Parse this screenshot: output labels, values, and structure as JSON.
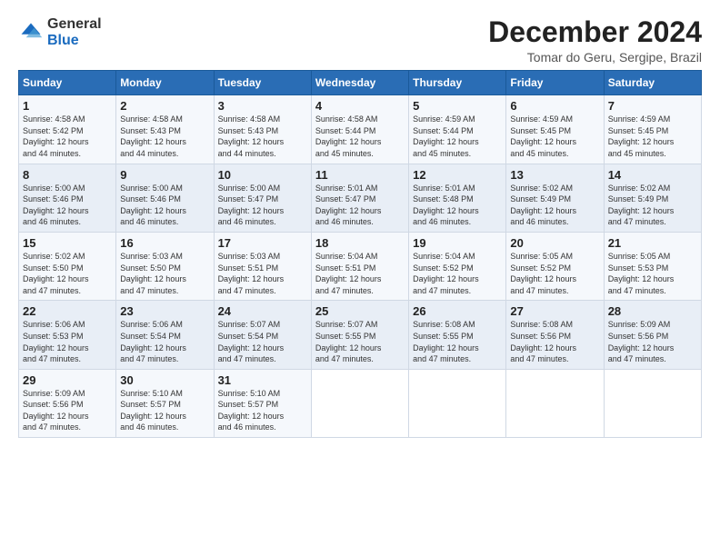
{
  "logo": {
    "general": "General",
    "blue": "Blue"
  },
  "title": "December 2024",
  "location": "Tomar do Geru, Sergipe, Brazil",
  "days_of_week": [
    "Sunday",
    "Monday",
    "Tuesday",
    "Wednesday",
    "Thursday",
    "Friday",
    "Saturday"
  ],
  "weeks": [
    [
      {
        "day": "1",
        "sunrise": "4:58 AM",
        "sunset": "5:42 PM",
        "daylight": "12 hours and 44 minutes."
      },
      {
        "day": "2",
        "sunrise": "4:58 AM",
        "sunset": "5:43 PM",
        "daylight": "12 hours and 44 minutes."
      },
      {
        "day": "3",
        "sunrise": "4:58 AM",
        "sunset": "5:43 PM",
        "daylight": "12 hours and 44 minutes."
      },
      {
        "day": "4",
        "sunrise": "4:58 AM",
        "sunset": "5:44 PM",
        "daylight": "12 hours and 45 minutes."
      },
      {
        "day": "5",
        "sunrise": "4:59 AM",
        "sunset": "5:44 PM",
        "daylight": "12 hours and 45 minutes."
      },
      {
        "day": "6",
        "sunrise": "4:59 AM",
        "sunset": "5:45 PM",
        "daylight": "12 hours and 45 minutes."
      },
      {
        "day": "7",
        "sunrise": "4:59 AM",
        "sunset": "5:45 PM",
        "daylight": "12 hours and 45 minutes."
      }
    ],
    [
      {
        "day": "8",
        "sunrise": "5:00 AM",
        "sunset": "5:46 PM",
        "daylight": "12 hours and 46 minutes."
      },
      {
        "day": "9",
        "sunrise": "5:00 AM",
        "sunset": "5:46 PM",
        "daylight": "12 hours and 46 minutes."
      },
      {
        "day": "10",
        "sunrise": "5:00 AM",
        "sunset": "5:47 PM",
        "daylight": "12 hours and 46 minutes."
      },
      {
        "day": "11",
        "sunrise": "5:01 AM",
        "sunset": "5:47 PM",
        "daylight": "12 hours and 46 minutes."
      },
      {
        "day": "12",
        "sunrise": "5:01 AM",
        "sunset": "5:48 PM",
        "daylight": "12 hours and 46 minutes."
      },
      {
        "day": "13",
        "sunrise": "5:02 AM",
        "sunset": "5:49 PM",
        "daylight": "12 hours and 46 minutes."
      },
      {
        "day": "14",
        "sunrise": "5:02 AM",
        "sunset": "5:49 PM",
        "daylight": "12 hours and 47 minutes."
      }
    ],
    [
      {
        "day": "15",
        "sunrise": "5:02 AM",
        "sunset": "5:50 PM",
        "daylight": "12 hours and 47 minutes."
      },
      {
        "day": "16",
        "sunrise": "5:03 AM",
        "sunset": "5:50 PM",
        "daylight": "12 hours and 47 minutes."
      },
      {
        "day": "17",
        "sunrise": "5:03 AM",
        "sunset": "5:51 PM",
        "daylight": "12 hours and 47 minutes."
      },
      {
        "day": "18",
        "sunrise": "5:04 AM",
        "sunset": "5:51 PM",
        "daylight": "12 hours and 47 minutes."
      },
      {
        "day": "19",
        "sunrise": "5:04 AM",
        "sunset": "5:52 PM",
        "daylight": "12 hours and 47 minutes."
      },
      {
        "day": "20",
        "sunrise": "5:05 AM",
        "sunset": "5:52 PM",
        "daylight": "12 hours and 47 minutes."
      },
      {
        "day": "21",
        "sunrise": "5:05 AM",
        "sunset": "5:53 PM",
        "daylight": "12 hours and 47 minutes."
      }
    ],
    [
      {
        "day": "22",
        "sunrise": "5:06 AM",
        "sunset": "5:53 PM",
        "daylight": "12 hours and 47 minutes."
      },
      {
        "day": "23",
        "sunrise": "5:06 AM",
        "sunset": "5:54 PM",
        "daylight": "12 hours and 47 minutes."
      },
      {
        "day": "24",
        "sunrise": "5:07 AM",
        "sunset": "5:54 PM",
        "daylight": "12 hours and 47 minutes."
      },
      {
        "day": "25",
        "sunrise": "5:07 AM",
        "sunset": "5:55 PM",
        "daylight": "12 hours and 47 minutes."
      },
      {
        "day": "26",
        "sunrise": "5:08 AM",
        "sunset": "5:55 PM",
        "daylight": "12 hours and 47 minutes."
      },
      {
        "day": "27",
        "sunrise": "5:08 AM",
        "sunset": "5:56 PM",
        "daylight": "12 hours and 47 minutes."
      },
      {
        "day": "28",
        "sunrise": "5:09 AM",
        "sunset": "5:56 PM",
        "daylight": "12 hours and 47 minutes."
      }
    ],
    [
      {
        "day": "29",
        "sunrise": "5:09 AM",
        "sunset": "5:56 PM",
        "daylight": "12 hours and 47 minutes."
      },
      {
        "day": "30",
        "sunrise": "5:10 AM",
        "sunset": "5:57 PM",
        "daylight": "12 hours and 46 minutes."
      },
      {
        "day": "31",
        "sunrise": "5:10 AM",
        "sunset": "5:57 PM",
        "daylight": "12 hours and 46 minutes."
      },
      null,
      null,
      null,
      null
    ]
  ],
  "labels": {
    "sunrise": "Sunrise:",
    "sunset": "Sunset:",
    "daylight": "Daylight:"
  }
}
